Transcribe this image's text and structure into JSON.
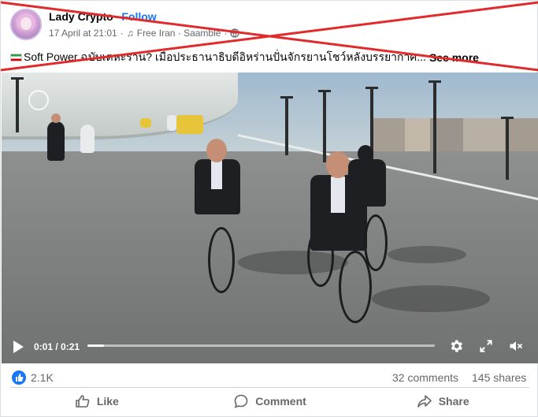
{
  "post": {
    "author": "Lady Crypto",
    "separator": "·",
    "follow_label": "Follow",
    "date": "17 April at 21:01",
    "music_label": "Free Iran · Saamble",
    "caption": "Soft Power ฉบับเตหะราน? เมื่อประธานาธิบดีอิหร่านปั่นจักรยานโชว์หลังบรรยากาศ...",
    "see_more": "See more"
  },
  "video": {
    "current_time": "0:01",
    "duration": "0:21",
    "time_display": "0:01 / 0:21",
    "progress": 0.048
  },
  "stats": {
    "reactions": "2.1K",
    "comments": "32 comments",
    "shares": "145 shares"
  },
  "actions": {
    "like": "Like",
    "comment": "Comment",
    "share": "Share"
  },
  "colors": {
    "brand": "#1877f2",
    "cross": "#e32a2a",
    "text_secondary": "#65676b"
  }
}
